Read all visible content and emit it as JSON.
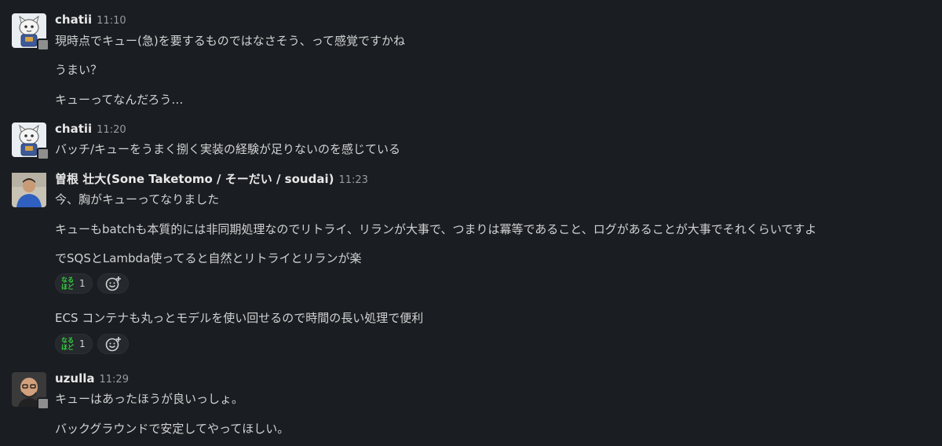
{
  "messages": [
    {
      "author": "chatii",
      "time": "11:10",
      "avatar_icon": "robot-cat-avatar",
      "lines": [
        "現時点でキュー(急)を要するものではなさそう、って感覚ですかね",
        "うまい？",
        "キューってなんだろう…"
      ]
    },
    {
      "author": "chatii",
      "time": "11:20",
      "avatar_icon": "robot-cat-avatar",
      "lines": [
        "バッチ/キューをうまく捌く実装の経験が足りないのを感じている"
      ]
    },
    {
      "author": "曽根 壮大(Sone Taketomo / そーだい / soudai)",
      "time": "11:23",
      "avatar_icon": "person-photo-avatar",
      "lines": [
        "今、胸がキューってなりました",
        "キューもbatchも本質的には非同期処理なのでリトライ、リランが大事で、つまりは冪等であること、ログがあることが大事でそれくらいですよ",
        "でSQSとLambda使ってると自然とリトライとリランが楽",
        "ECS コンテナも丸っとモデルを使い回せるので時間の長い処理で便利"
      ],
      "reactions": [
        {
          "emoji_top": "なる",
          "emoji_bottom": "ほど",
          "count": "1"
        },
        {
          "emoji_top": "なる",
          "emoji_bottom": "ほど",
          "count": "1"
        }
      ]
    },
    {
      "author": "uzulla",
      "time": "11:29",
      "avatar_icon": "bald-person-avatar",
      "lines": [
        "キューはあったほうが良いっしょ。",
        "バックグラウンドで安定してやってほしい。"
      ]
    }
  ],
  "colors": {
    "background": "#1a1d21",
    "text": "#d1d2d3",
    "timestamp": "#9a9b9d",
    "reaction_emoji": "#34d33f"
  }
}
